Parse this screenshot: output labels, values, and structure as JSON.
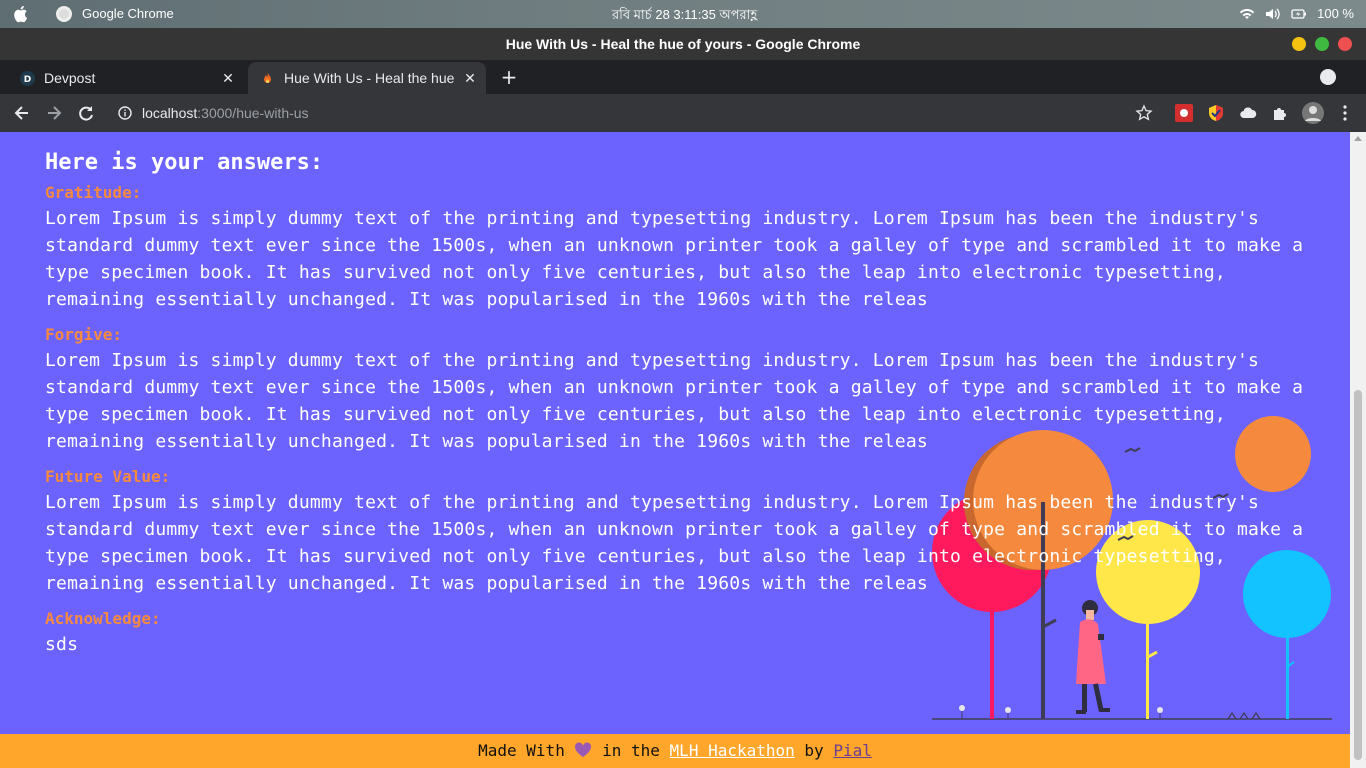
{
  "os_bar": {
    "app_name": "Google Chrome",
    "clock": "রবি মার্চ 28   3:11:35 অপরাহ্ণ",
    "battery": "100 %"
  },
  "window": {
    "title": "Hue With Us - Heal the hue of yours - Google Chrome"
  },
  "tabs": [
    {
      "label": "Devpost",
      "favicon": "D"
    },
    {
      "label": "Hue With Us - Heal the hue of yours",
      "favicon": "flame-icon"
    }
  ],
  "toolbar": {
    "url_host": "localhost",
    "url_path": ":3000/hue-with-us"
  },
  "page": {
    "heading": "Here is your answers:",
    "sections": [
      {
        "label": "Gratitude:",
        "text": "Lorem Ipsum is simply dummy text of the printing and typesetting industry. Lorem Ipsum has been the industry's standard dummy text ever since the 1500s, when an unknown printer took a galley of type and scrambled it to make a type specimen book. It has survived not only five centuries, but also the leap into electronic typesetting, remaining essentially unchanged. It was popularised in the 1960s with the releas"
      },
      {
        "label": "Forgive:",
        "text": "Lorem Ipsum is simply dummy text of the printing and typesetting industry. Lorem Ipsum has been the industry's standard dummy text ever since the 1500s, when an unknown printer took a galley of type and scrambled it to make a type specimen book. It has survived not only five centuries, but also the leap into electronic typesetting, remaining essentially unchanged. It was popularised in the 1960s with the releas"
      },
      {
        "label": "Future Value:",
        "text": "Lorem Ipsum is simply dummy text of the printing and typesetting industry. Lorem Ipsum has been the industry's standard dummy text ever since the 1500s, when an unknown printer took a galley of type and scrambled it to make a type specimen book. It has survived not only five centuries, but also the leap into electronic typesetting, remaining essentially unchanged. It was popularised in the 1960s with the releas"
      },
      {
        "label": "Acknowledge:",
        "text": "sds"
      }
    ]
  },
  "footer": {
    "made_with": "Made With",
    "in_the": "in the",
    "hackathon_link": "MLH Hackathon",
    "by": "by",
    "author_link": "Pial"
  },
  "colors": {
    "page_bg": "#6c63ff",
    "label": "#f58a3f",
    "footer_bg": "#ffa62b"
  }
}
